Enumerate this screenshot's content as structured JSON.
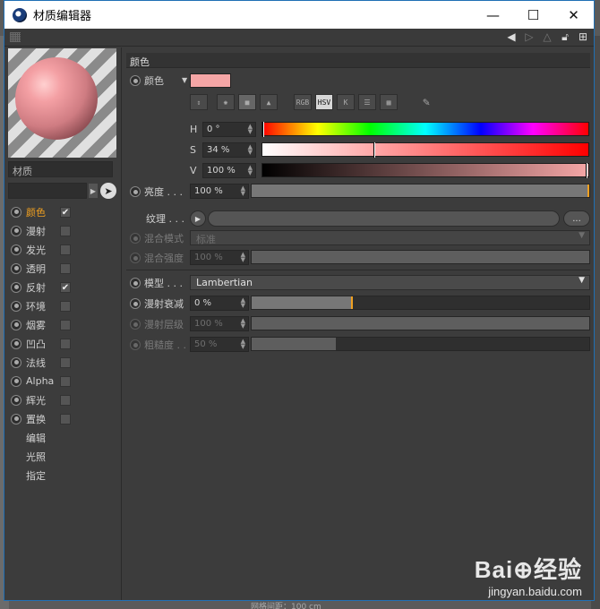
{
  "window": {
    "title": "材质编辑器",
    "minimize": "—",
    "maximize": "☐",
    "close": "✕"
  },
  "left": {
    "material_name": "材质",
    "channels": [
      {
        "label": "颜色",
        "checked": true,
        "active": true
      },
      {
        "label": "漫射",
        "checked": false
      },
      {
        "label": "发光",
        "checked": false
      },
      {
        "label": "透明",
        "checked": false
      },
      {
        "label": "反射",
        "checked": true
      },
      {
        "label": "环境",
        "checked": false
      },
      {
        "label": "烟雾",
        "checked": false
      },
      {
        "label": "凹凸",
        "checked": false
      },
      {
        "label": "法线",
        "checked": false
      },
      {
        "label": "Alpha",
        "checked": false
      },
      {
        "label": "辉光",
        "checked": false
      },
      {
        "label": "置换",
        "checked": false
      }
    ],
    "extra": [
      "编辑",
      "光照",
      "指定"
    ]
  },
  "color": {
    "section_title": "颜色",
    "label": "颜色",
    "swatch": "#f5a6a6",
    "modes": [
      "RGB",
      "HSV",
      "K"
    ],
    "h_label": "H",
    "h_value": "0 °",
    "s_label": "S",
    "s_value": "34 %",
    "s_fraction": 0.34,
    "v_label": "V",
    "v_value": "100 %",
    "v_fraction": 1.0,
    "brightness_label": "亮度 . . .",
    "brightness_value": "100 %",
    "brightness_fraction": 1.0,
    "texture_label": "纹理 . . .",
    "texture_dots": "...",
    "blend_mode_label": "混合模式",
    "blend_mode_value": "标准",
    "blend_strength_label": "混合强度",
    "blend_strength_value": "100 %",
    "blend_strength_fraction": 1.0
  },
  "model": {
    "label": "模型 . . .",
    "value": "Lambertian",
    "diffuse_falloff_label": "漫射衰减",
    "diffuse_falloff_value": "0 %",
    "diffuse_falloff_fraction": 0.3,
    "diffuse_level_label": "漫射层级",
    "diffuse_level_value": "100 %",
    "diffuse_level_fraction": 1.0,
    "roughness_label": "粗糙度 . .",
    "roughness_value": "50 %",
    "roughness_fraction": 0.25
  },
  "watermark": {
    "logo": "Bai⊕经验",
    "url": "jingyan.baidu.com"
  },
  "status": "网格间距：100 cm"
}
